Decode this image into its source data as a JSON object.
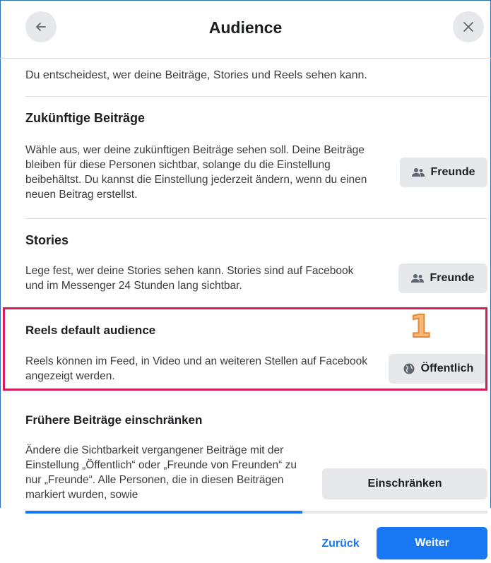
{
  "header": {
    "title": "Audience",
    "back_icon": "arrow-left-icon",
    "close_icon": "close-icon"
  },
  "intro": "Du entscheidest, wer deine Beiträge, Stories und Reels sehen kann.",
  "sections": [
    {
      "title": "Zukünftige Beiträge",
      "text": "Wähle aus, wer deine zukünftigen Beiträge sehen soll. Deine Beiträge bleiben für diese Personen sichtbar, solange du die Einstellung beibehältst. Du kannst die Einstellung jederzeit ändern, wenn du einen neuen Beitrag erstellst.",
      "button_label": "Freunde",
      "button_icon": "friends-icon"
    },
    {
      "title": "Stories",
      "text": "Lege fest, wer deine Stories sehen kann. Stories sind auf Facebook und im Messenger 24 Stunden lang sichtbar.",
      "button_label": "Freunde",
      "button_icon": "friends-icon"
    },
    {
      "title": "Reels default audience",
      "text": "Reels können im Feed, in Video und an weiteren Stellen auf Facebook angezeigt werden.",
      "button_label": "Öffentlich",
      "button_icon": "globe-icon"
    },
    {
      "title": "Frühere Beiträge einschränken",
      "text": "Ändere die Sichtbarkeit vergangener Beiträge mit der Einstellung „Öffentlich“ oder „Freunde von Freunden“ zu nur „Freunde“. Alle Personen, die in diesen Beiträgen markiert wurden, sowie",
      "button_label": "Einschränken"
    }
  ],
  "annotation_marker": "1",
  "colors": {
    "accent": "#1877f2",
    "highlight": "#d81b5a",
    "marker": "#f5b97a",
    "button_bg": "#e6e8ec"
  },
  "progress": {
    "fraction": 0.6
  },
  "footer": {
    "back_label": "Zurück",
    "next_label": "Weiter"
  }
}
